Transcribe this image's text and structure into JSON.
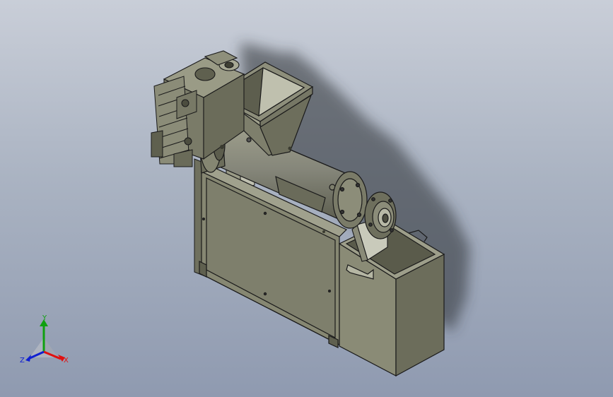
{
  "viewport": {
    "background_top": "#c9ced8",
    "background_bottom": "#8f9ab0"
  },
  "model": {
    "body_color": "#7e7f6c",
    "body_dark": "#5f604f",
    "body_light": "#9a9b86",
    "outline": "#1a1a1a"
  },
  "triad": {
    "x_label": "X",
    "y_label": "Y",
    "z_label": "Z",
    "x_color": "#e01010",
    "y_color": "#10a010",
    "z_color": "#1020d0"
  }
}
